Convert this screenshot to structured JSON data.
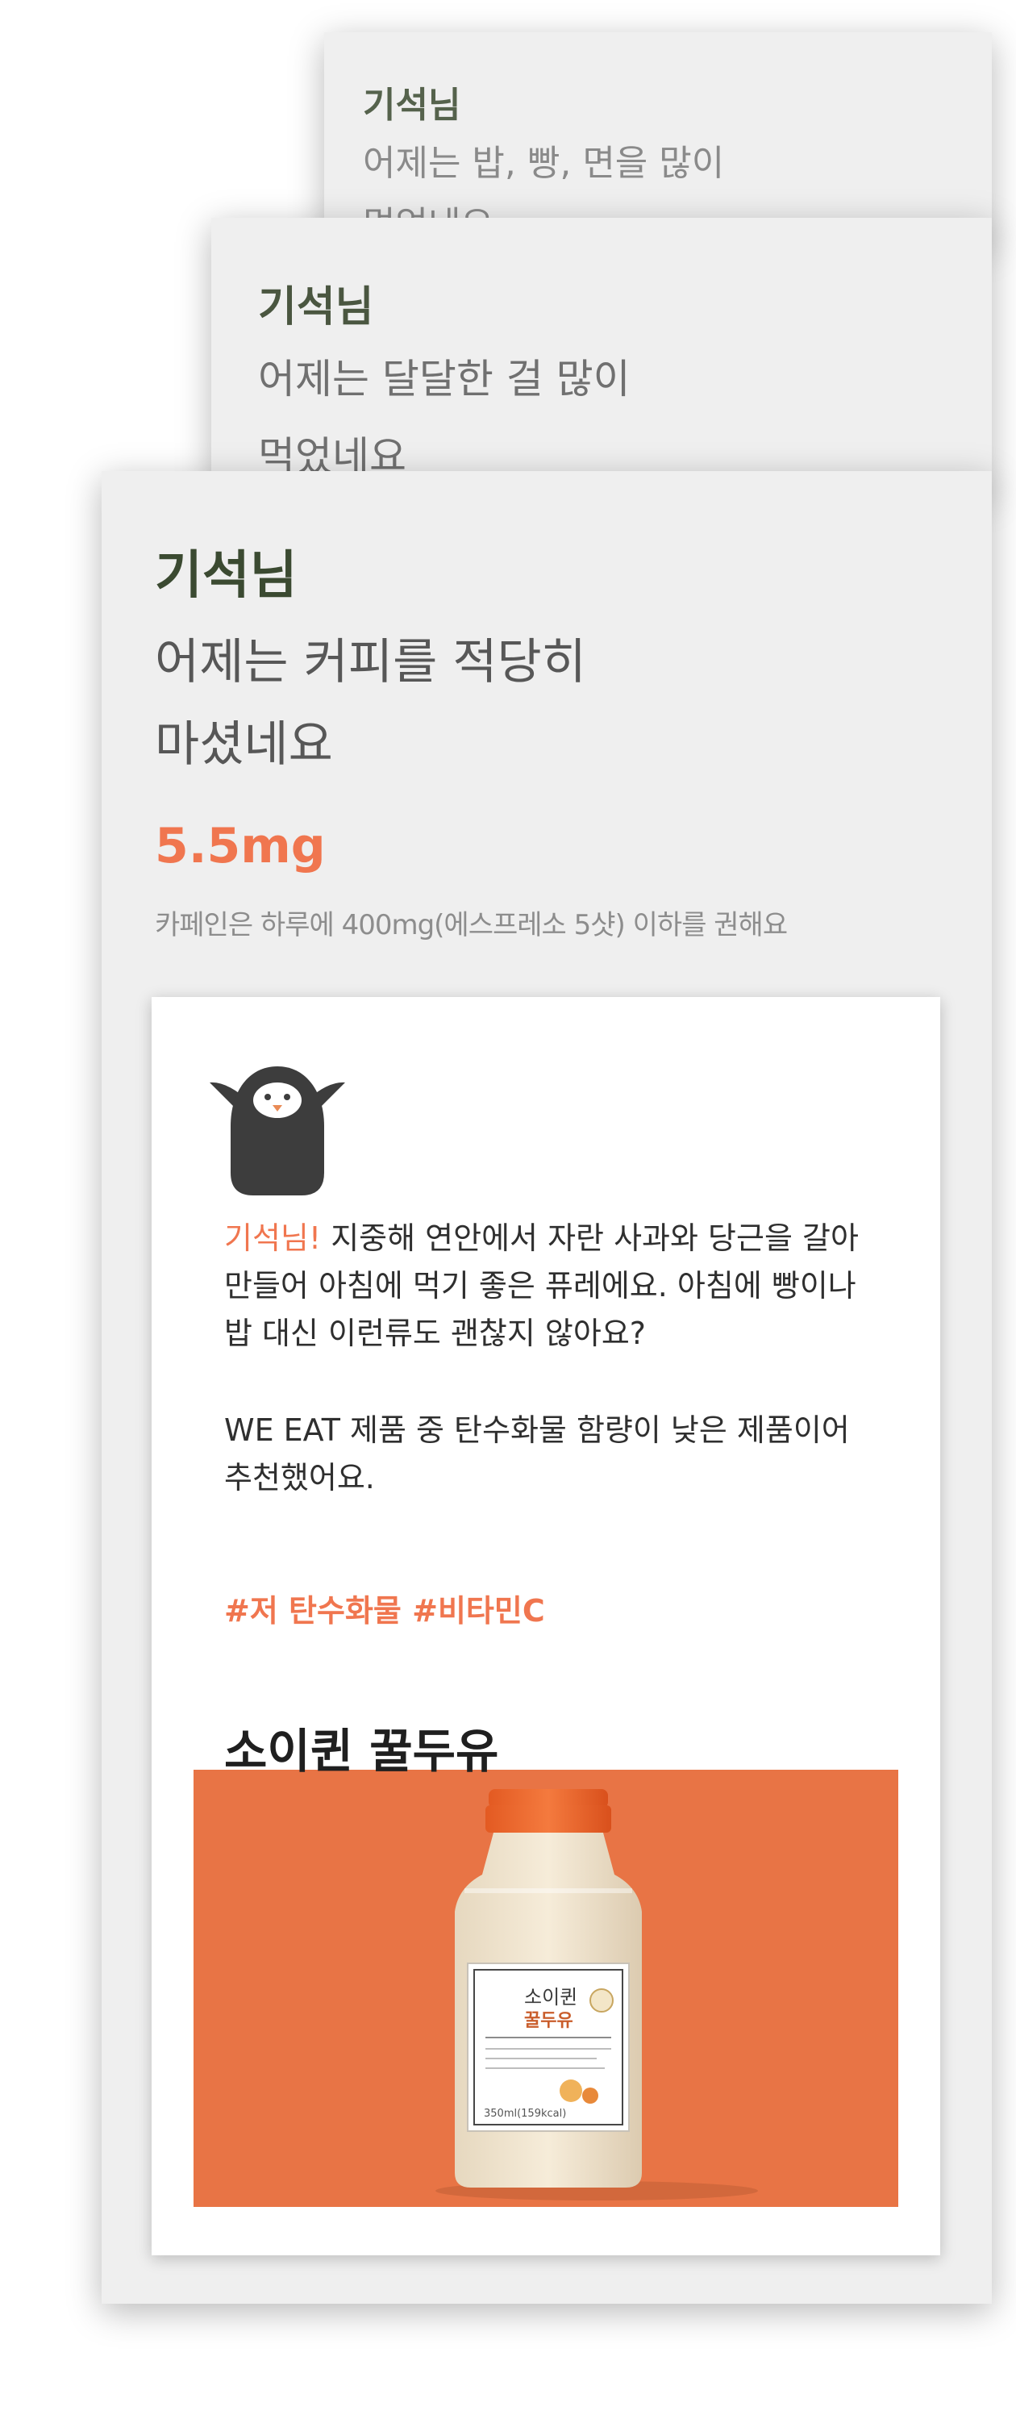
{
  "cards": {
    "back": {
      "name": "기석님",
      "line1": "어제는 밥, 빵, 면을 많이",
      "line2": "먹었네요"
    },
    "middle": {
      "name": "기석님",
      "line1": "어제는 달달한 걸 많이",
      "line2": "먹었네요"
    },
    "front": {
      "name": "기석님",
      "line1": "어제는 커피를 적당히",
      "line2": "마셨네요",
      "amount": "5.5mg",
      "caption": "카페인은 하루에 400mg(에스프레소 5샷) 이하를 권해요"
    }
  },
  "recommendation": {
    "mascot_icon": "penguin-icon",
    "greeting": "기석님!",
    "line1_rest": " 지중해 연안에서 자란 사과와 당근을 갈아",
    "line2": "만들어 아침에 먹기 좋은 퓨레에요. 아침에 빵이나",
    "line3": "밥 대신 이런류도 괜찮지 않아요?",
    "line4": "WE EAT 제품 중 탄수화물 함량이 낮은 제품이어",
    "line5": "추천했어요.",
    "hashtags": "#저 탄수화물 #비타민C",
    "product_name": "소이퀸 꿀두유",
    "bottle": {
      "brand": "소이퀸",
      "flavor": "꿀두유",
      "volume": "350ml(159kcal)"
    }
  },
  "colors": {
    "accent": "#f0764f",
    "photo_background": "#e87445",
    "card_background": "#efefef",
    "heading": "#3b4a31"
  }
}
